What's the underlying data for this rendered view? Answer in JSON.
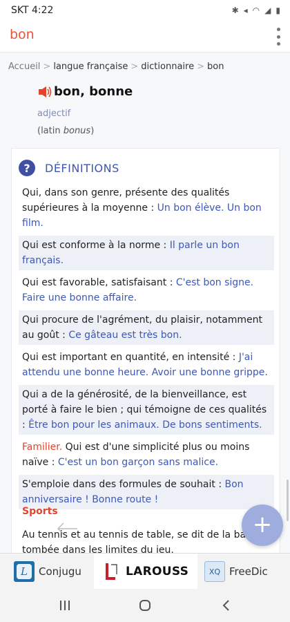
{
  "status_bar": {
    "carrier_time": "SKT 4:22",
    "icons": [
      "fan-icon",
      "bluetooth-icon",
      "mute-icon",
      "wifi-icon",
      "signal-icon",
      "battery-icon"
    ]
  },
  "search": {
    "query": "bon"
  },
  "breadcrumb": {
    "items": [
      "Accueil",
      "langue française",
      "dictionnaire",
      "bon"
    ],
    "separator": ">"
  },
  "entry": {
    "headword": "bon, bonne",
    "part_of_speech": "adjectif",
    "etymology_prefix": "(latin ",
    "etymology_word": "bonus",
    "etymology_suffix": ")"
  },
  "definitions": {
    "title": "DÉFINITIONS",
    "items": [
      {
        "text": "Qui, dans son genre, présente des qualités supérieures à la moyenne : ",
        "example": "Un bon élève. Un bon film."
      },
      {
        "text": "Qui est conforme à la norme : ",
        "example": "Il parle un bon français."
      },
      {
        "text": "Qui est favorable, satisfaisant : ",
        "example": "C'est bon signe. Faire une bonne affaire."
      },
      {
        "text": "Qui procure de l'agrément, du plaisir, notamment au goût : ",
        "example": "Ce gâteau est très bon."
      },
      {
        "text": "Qui est important en quantité, en intensité : ",
        "example": "J'ai attendu une bonne heure. Avoir une bonne grippe."
      },
      {
        "text": "Qui a de la générosité, de la bienveillance, est porté à faire le bien ; qui témoigne de ces qualités : ",
        "example": "Être bon pour les animaux. De bons sentiments."
      },
      {
        "register": "Familier.",
        "text": " Qui est d'une simplicité plus ou moins naïve : ",
        "example": "C'est un bon garçon sans malice."
      },
      {
        "text": "S'emploie dans des formules de souhait : ",
        "example": "Bon anniversaire ! Bonne route !"
      }
    ]
  },
  "sports": {
    "title": "Sports",
    "text": "Au tennis et au tennis de table, se dit de la balle tombée dans les limites du jeu."
  },
  "fab": {
    "symbol": "+"
  },
  "tabs": [
    {
      "label": "Conjugu",
      "icon": "conjugaison-app-icon"
    },
    {
      "label": "LAROUSS",
      "icon": "larousse-app-icon"
    },
    {
      "label": "FreeDic",
      "icon": "freedic-app-icon"
    }
  ],
  "colors": {
    "query": "#e8543a",
    "accent_blue": "#3f56a8",
    "example_blue": "#3d58b5",
    "register_red": "#e0452e",
    "fab": "#9eadde"
  }
}
